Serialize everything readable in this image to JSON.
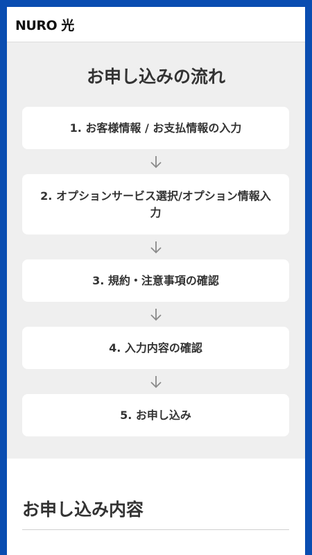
{
  "header": {
    "logo": "NURO 光"
  },
  "flow": {
    "title": "お申し込みの流れ",
    "steps": [
      {
        "label": "1. お客様情報 / お支払情報の入力"
      },
      {
        "label": "2. オプションサービス選択/オプション情報入力"
      },
      {
        "label": "3. 規約・注意事項の確認"
      },
      {
        "label": "4. 入力内容の確認"
      },
      {
        "label": "5. お申し込み"
      }
    ]
  },
  "section": {
    "title": "お申し込み内容"
  },
  "colors": {
    "frame_border": "#0a4db1",
    "panel_background": "#efefef",
    "card_background": "#ffffff",
    "text": "#333333"
  },
  "icons": {
    "arrow": "arrow-down-icon"
  }
}
